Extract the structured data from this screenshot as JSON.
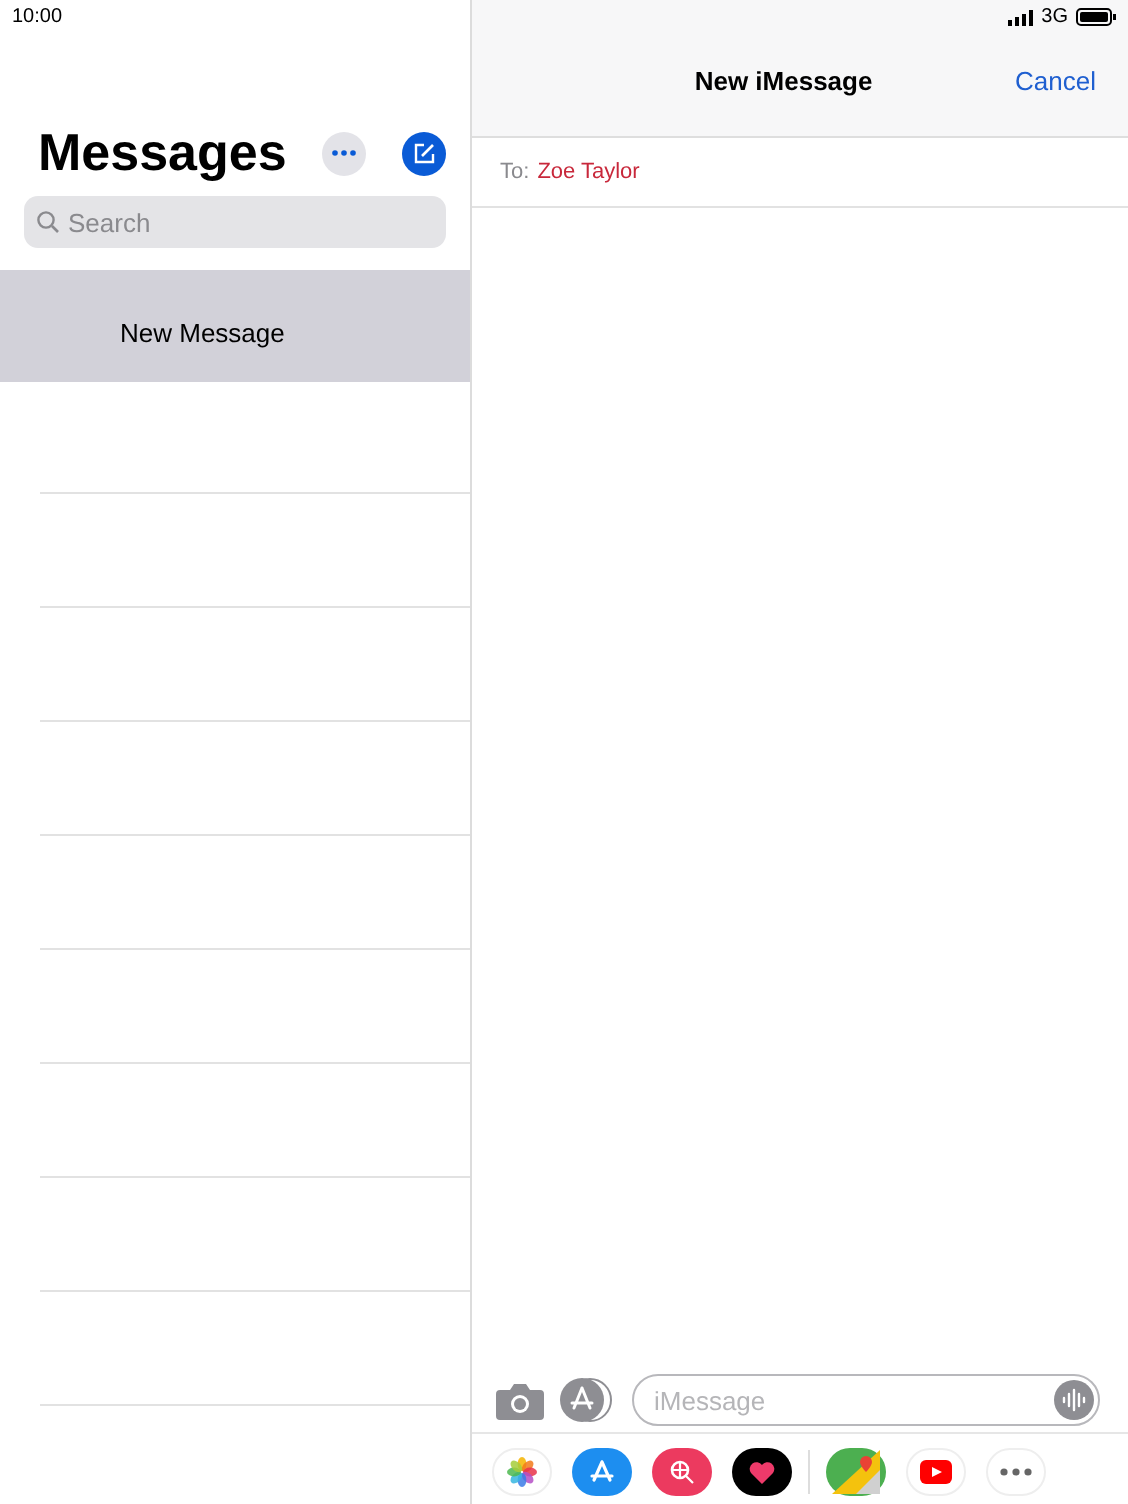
{
  "status_bar": {
    "time": "10:00",
    "network": "3G"
  },
  "sidebar": {
    "title": "Messages",
    "search": {
      "placeholder": "Search"
    },
    "conversations": [
      {
        "title": "New Message",
        "selected": true
      }
    ]
  },
  "compose": {
    "title": "New iMessage",
    "cancel": "Cancel",
    "to_label": "To:",
    "recipient": "Zoe Taylor",
    "message_field": {
      "placeholder": "iMessage"
    },
    "app_drawer": [
      {
        "kind": "photos"
      },
      {
        "kind": "appstore"
      },
      {
        "kind": "search"
      },
      {
        "kind": "heart"
      },
      {
        "kind": "maps"
      },
      {
        "kind": "video"
      },
      {
        "kind": "more"
      }
    ]
  }
}
